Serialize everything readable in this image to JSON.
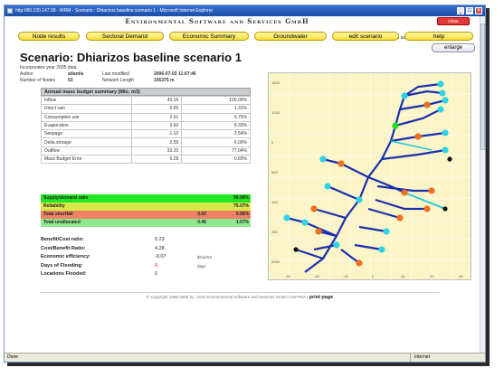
{
  "window": {
    "title": "http://80.120.147.38 - WRM - Scenario : Dhiarizos baseline scenario 1 - Microsoft Internet Explorer",
    "min": "_",
    "max": "□",
    "close": "×"
  },
  "header": {
    "logo": "Environmental Software and Services GmbH",
    "close_label": "close",
    "logged_in_as": "logged in as",
    "user": "guest"
  },
  "nav": [
    "Node results",
    "Sectoral Demand",
    "Economic Summary",
    "Groundwater",
    "edit scenario",
    "help"
  ],
  "enlarge": "enlarge",
  "scenario": {
    "title": "Scenario: Dhiarizos baseline scenario 1",
    "incorporates": "Incorporates year 2005 data",
    "author_label": "Author",
    "author": "atlantis",
    "modified_label": "Last modified",
    "modified": "2006-07-03 11:07:46",
    "nodes_label": "Number of Nodes",
    "nodes": "53",
    "length_label": "Network Length",
    "length": "155375 m"
  },
  "budget": {
    "title": "Annual mass budget summary (Mio. m3)",
    "rows": [
      {
        "label": "Inflow",
        "value": "43.16",
        "pct": "100.00%"
      },
      {
        "label": "Direct rain",
        "value": "0.56",
        "pct": "1.31%"
      },
      {
        "label": "Consumptive use",
        "value": "2.91",
        "pct": "6.75%"
      },
      {
        "label": "Evaporation",
        "value": "3.60",
        "pct": "8.33%"
      },
      {
        "label": "Seepage",
        "value": "1.10",
        "pct": "2.54%"
      },
      {
        "label": "Delta storage",
        "value": "2.59",
        "pct": "6.00%"
      },
      {
        "label": "Outflow",
        "value": "33.20",
        "pct": "77.04%"
      },
      {
        "label": "Mass Budget Error",
        "value": "0.28",
        "pct": "0.65%"
      }
    ]
  },
  "ratios": [
    {
      "label": "Supply/demand ratio",
      "value": "",
      "pct": "99.98%",
      "color": "#22e622"
    },
    {
      "label": "Reliability",
      "value": "",
      "pct": "75.07%",
      "color": "#d8e84a"
    },
    {
      "label": "Total shortfall",
      "value": "0.02",
      "pct": "0.06%",
      "color": "#ef8266"
    },
    {
      "label": "Total unallocated",
      "value": "0.46",
      "pct": "1.07%",
      "color": "#8fe88f"
    }
  ],
  "indicators": [
    {
      "label": "Benefit/Cost ratio:",
      "value": "0.23",
      "unit": ""
    },
    {
      "label": "Cost/Benefit Ratio:",
      "value": "4.28",
      "unit": ""
    },
    {
      "label": "Economic efficiency:",
      "value": "-0.07",
      "unit": "$Cu/m3"
    },
    {
      "label": "Days of Flooding:",
      "value": "0",
      "unit": "days"
    },
    {
      "label": "Locations Flooded:",
      "value": "0",
      "unit": ""
    }
  ],
  "footer": {
    "copyright": "© Copyright 1995-2005 by : ESS Environmental Software and Services GmbH AUSTRIA",
    "print": "print page"
  },
  "map": {
    "y_ticks": [
      "1400",
      "1200",
      "0",
      "600",
      "400",
      "200",
      "2000"
    ],
    "x_ticks": [
      "-30",
      "-20",
      "-10",
      "0",
      "10",
      "20",
      "30"
    ]
  },
  "status": {
    "left": "Done",
    "zone": "Internet"
  }
}
